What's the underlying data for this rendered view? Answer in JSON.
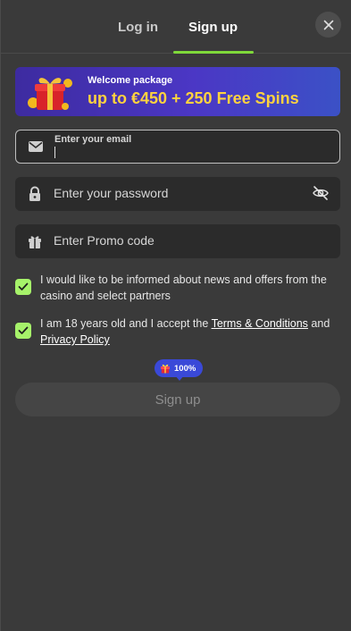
{
  "tabs": {
    "login_label": "Log in",
    "signup_label": "Sign up",
    "active": "signup"
  },
  "banner": {
    "title": "Welcome package",
    "offer": "up to €450 + 250 Free Spins"
  },
  "fields": {
    "email": {
      "label": "Enter your email",
      "value": ""
    },
    "password": {
      "placeholder": "Enter your password"
    },
    "promo": {
      "placeholder": "Enter Promo code"
    }
  },
  "checkboxes": {
    "news": {
      "text": "I would like to be informed about news and offers from the casino and select partners",
      "checked": true
    },
    "age": {
      "prefix": "I am 18 years old and I accept the ",
      "terms_link": "Terms & Conditions",
      "middle": " and ",
      "privacy_link": "Privacy Policy",
      "checked": true
    }
  },
  "badge": {
    "text": "100%"
  },
  "signup_button": {
    "label": "Sign up"
  },
  "icons": {
    "close": "close-icon",
    "email": "envelope-icon",
    "password": "lock-icon",
    "visibility": "eye-off-icon",
    "promo": "gift-icon",
    "check": "check-icon",
    "badge": "gift-icon"
  },
  "colors": {
    "accent": "#7fd93a",
    "checkbox": "#a6f26a",
    "banner_offer": "#ffd23f",
    "badge_bg": "#3a49d8",
    "background": "#3a3a3a",
    "field_bg": "#2b2b2b"
  }
}
